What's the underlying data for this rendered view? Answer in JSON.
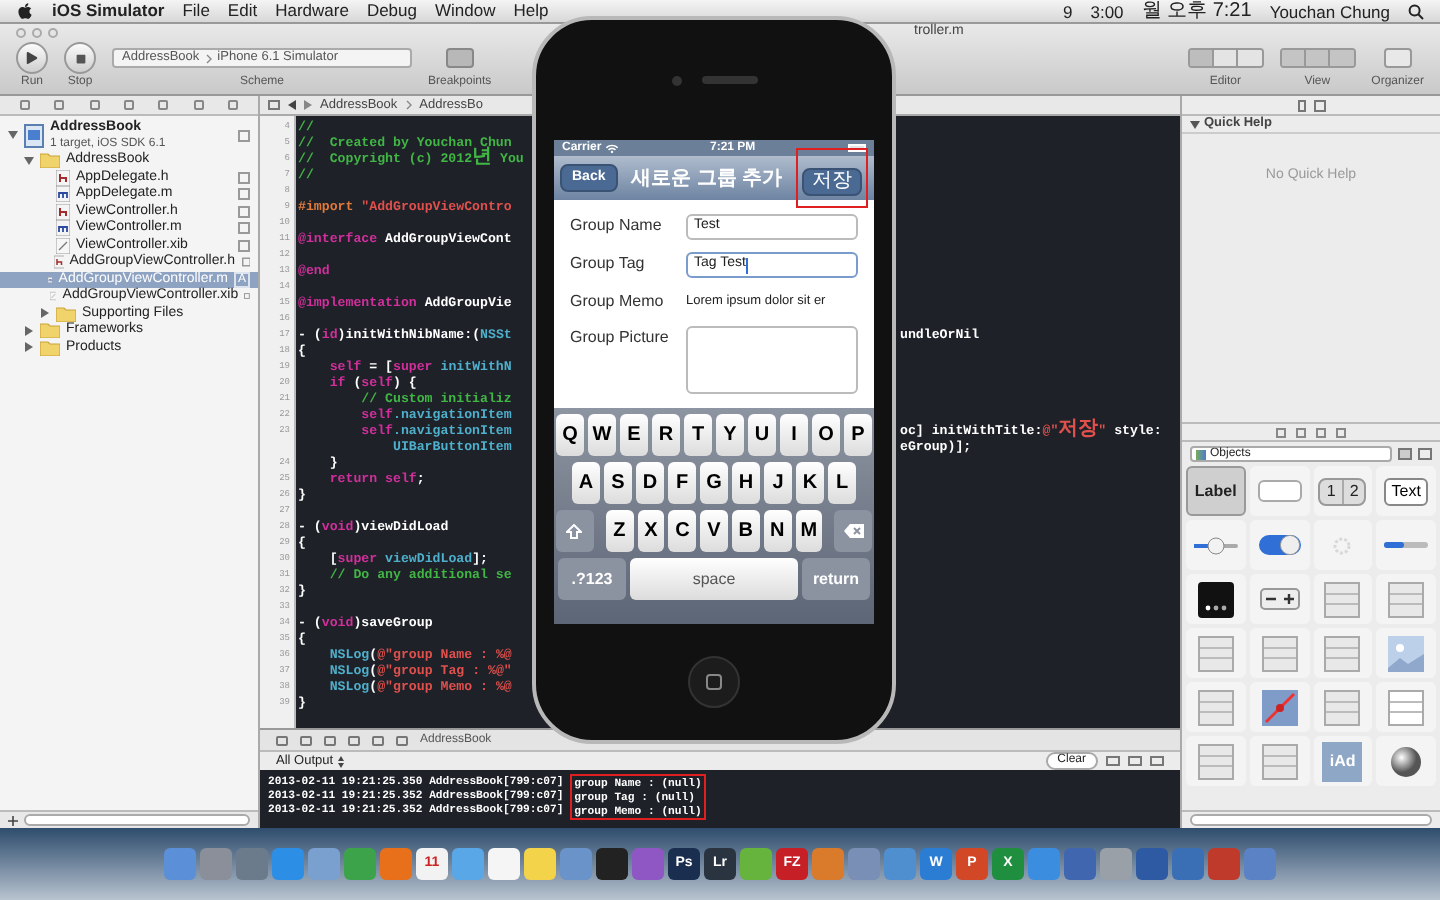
{
  "menu_bar": {
    "app": "iOS Simulator",
    "items": [
      "File",
      "Edit",
      "Hardware",
      "Debug",
      "Window",
      "Help"
    ],
    "status": [
      "9",
      "3:00",
      "월 오후 7:21",
      "Youchan Chung"
    ]
  },
  "toolbar": {
    "title": "troller.m",
    "run": "Run",
    "stop": "Stop",
    "scheme_target": "AddressBook",
    "scheme_device": "iPhone 6.1 Simulator",
    "scheme_label": "Scheme",
    "breakpoints": "Breakpoints",
    "editor": "Editor",
    "view": "View",
    "organizer": "Organizer"
  },
  "navigator": {
    "tree": [
      {
        "label": "AddressBook",
        "detail": "1 target, iOS SDK 6.1",
        "kind": "project",
        "expanded": true,
        "selected": false,
        "children": [
          {
            "label": "AddressBook",
            "kind": "group",
            "expanded": true,
            "selected": false,
            "children": [
              {
                "label": "AppDelegate.h",
                "kind": "header",
                "selected": false
              },
              {
                "label": "AppDelegate.m",
                "kind": "source",
                "selected": false
              },
              {
                "label": "ViewController.h",
                "kind": "header",
                "selected": false
              },
              {
                "label": "ViewController.m",
                "kind": "source",
                "selected": false
              },
              {
                "label": "ViewController.xib",
                "kind": "xib",
                "selected": false
              },
              {
                "label": "AddGroupViewController.h",
                "kind": "header",
                "selected": false
              },
              {
                "label": "AddGroupViewController.m",
                "kind": "source",
                "selected": true,
                "status": "A"
              },
              {
                "label": "AddGroupViewController.xib",
                "kind": "xib",
                "selected": false
              },
              {
                "label": "Supporting Files",
                "kind": "group",
                "expanded": false,
                "selected": false
              }
            ]
          },
          {
            "label": "Frameworks",
            "kind": "group",
            "expanded": false,
            "selected": false
          },
          {
            "label": "Products",
            "kind": "group",
            "expanded": false,
            "selected": false
          }
        ]
      }
    ]
  },
  "jump_bar": [
    "AddressBook",
    "AddressBo"
  ],
  "code": [
    {
      "n": "4",
      "segs": [
        {
          "text": "//",
          "kind": "comment"
        }
      ]
    },
    {
      "n": "5",
      "segs": [
        {
          "text": "//  Created by Youchan Chun",
          "kind": "comment"
        }
      ]
    },
    {
      "n": "6",
      "segs": [
        {
          "text": "//  Copyright (c) 2012년 You",
          "kind": "comment"
        }
      ]
    },
    {
      "n": "7",
      "segs": [
        {
          "text": "//",
          "kind": "comment"
        }
      ]
    },
    {
      "n": "8"
    },
    {
      "n": "9",
      "segs": [
        {
          "text": "#import",
          "kind": "directive"
        },
        {
          "text": " \"AddGroupViewContro",
          "kind": "string"
        }
      ]
    },
    {
      "n": "10"
    },
    {
      "n": "11",
      "segs": [
        {
          "text": "@interface",
          "kind": "keyword"
        },
        {
          "text": " AddGroupViewCont",
          "kind": "plain"
        }
      ]
    },
    {
      "n": "12"
    },
    {
      "n": "13",
      "segs": [
        {
          "text": "@end",
          "kind": "keyword"
        }
      ]
    },
    {
      "n": "14"
    },
    {
      "n": "15",
      "segs": [
        {
          "text": "@implementation",
          "kind": "keyword"
        },
        {
          "text": " AddGroupVie",
          "kind": "plain"
        }
      ]
    },
    {
      "n": "16"
    },
    {
      "n": "17",
      "segs": [
        {
          "text": "- (",
          "kind": "plain"
        },
        {
          "text": "id",
          "kind": "keyword"
        },
        {
          "text": ")initWithNibName:(",
          "kind": "plain"
        },
        {
          "text": "NSSt",
          "kind": "type"
        }
      ],
      "right": [
        {
          "text": "undleOrNil",
          "kind": "plain"
        }
      ]
    },
    {
      "n": "18",
      "segs": [
        {
          "text": "{",
          "kind": "plain"
        }
      ]
    },
    {
      "n": "19",
      "segs": [
        {
          "text": "    self",
          "kind": "keyword"
        },
        {
          "text": " = [",
          "kind": "plain"
        },
        {
          "text": "super",
          "kind": "keyword"
        },
        {
          "text": " initWithN",
          "kind": "type"
        }
      ]
    },
    {
      "n": "20",
      "segs": [
        {
          "text": "    if",
          "kind": "keyword"
        },
        {
          "text": " (",
          "kind": "plain"
        },
        {
          "text": "self",
          "kind": "keyword"
        },
        {
          "text": ") {",
          "kind": "plain"
        }
      ]
    },
    {
      "n": "21",
      "segs": [
        {
          "text": "        // Custom initializ",
          "kind": "comment"
        }
      ]
    },
    {
      "n": "22",
      "segs": [
        {
          "text": "        self",
          "kind": "keyword"
        },
        {
          "text": ".navigationItem",
          "kind": "type"
        }
      ]
    },
    {
      "n": "23",
      "segs": [
        {
          "text": "        self",
          "kind": "keyword"
        },
        {
          "text": ".navigationItem",
          "kind": "type"
        }
      ],
      "right": [
        {
          "text": "oc] initWithTitle:",
          "kind": "plain"
        },
        {
          "text": "@\"저장\"",
          "kind": "string"
        },
        {
          "text": " style:",
          "kind": "plain"
        }
      ]
    },
    {
      "segs": [
        {
          "text": "            UIBarButtonItem",
          "kind": "type"
        }
      ],
      "right": [
        {
          "text": "eGroup)];",
          "kind": "plain"
        }
      ]
    },
    {
      "n": "24",
      "segs": [
        {
          "text": "    }",
          "kind": "plain"
        }
      ]
    },
    {
      "n": "25",
      "segs": [
        {
          "text": "    return",
          "kind": "keyword"
        },
        {
          "text": " self",
          "kind": "keyword"
        },
        {
          "text": ";",
          "kind": "plain"
        }
      ]
    },
    {
      "n": "26",
      "segs": [
        {
          "text": "}",
          "kind": "plain"
        }
      ]
    },
    {
      "n": "27"
    },
    {
      "n": "28",
      "segs": [
        {
          "text": "- (",
          "kind": "plain"
        },
        {
          "text": "void",
          "kind": "keyword"
        },
        {
          "text": ")viewDidLoad",
          "kind": "plain"
        }
      ]
    },
    {
      "n": "29",
      "segs": [
        {
          "text": "{",
          "kind": "plain"
        }
      ]
    },
    {
      "n": "30",
      "segs": [
        {
          "text": "    [",
          "kind": "plain"
        },
        {
          "text": "super",
          "kind": "keyword"
        },
        {
          "text": " viewDidLoad",
          "kind": "type"
        },
        {
          "text": "];",
          "kind": "plain"
        }
      ]
    },
    {
      "n": "31",
      "segs": [
        {
          "text": "    // Do any additional se",
          "kind": "comment"
        }
      ]
    },
    {
      "n": "32",
      "segs": [
        {
          "text": "}",
          "kind": "plain"
        }
      ]
    },
    {
      "n": "33"
    },
    {
      "n": "34",
      "segs": [
        {
          "text": "- (",
          "kind": "plain"
        },
        {
          "text": "void",
          "kind": "keyword"
        },
        {
          "text": ")saveGroup",
          "kind": "plain"
        }
      ]
    },
    {
      "n": "35",
      "segs": [
        {
          "text": "{",
          "kind": "plain"
        }
      ]
    },
    {
      "n": "36",
      "segs": [
        {
          "text": "    NSLog",
          "kind": "type"
        },
        {
          "text": "(",
          "kind": "plain"
        },
        {
          "text": "@\"group Name : %@",
          "kind": "string"
        }
      ]
    },
    {
      "n": "37",
      "segs": [
        {
          "text": "    NSLog",
          "kind": "type"
        },
        {
          "text": "(",
          "kind": "plain"
        },
        {
          "text": "@\"group Tag : %@\"",
          "kind": "string"
        }
      ]
    },
    {
      "n": "38",
      "segs": [
        {
          "text": "    NSLog",
          "kind": "type"
        },
        {
          "text": "(",
          "kind": "plain"
        },
        {
          "text": "@\"group Memo : %@",
          "kind": "string"
        }
      ]
    },
    {
      "n": "39",
      "segs": [
        {
          "text": "}",
          "kind": "plain"
        }
      ]
    }
  ],
  "debug": {
    "crumb": "AddressBook",
    "output_filter": "All Output",
    "clear": "Clear",
    "highlighted": true,
    "log": [
      {
        "prefix": "2013-02-11 19:21:25.350 AddressBook[799:c07]",
        "message": "group Name : (null)"
      },
      {
        "prefix": "2013-02-11 19:21:25.352 AddressBook[799:c07]",
        "message": "group Tag : (null)"
      },
      {
        "prefix": "2013-02-11 19:21:25.352 AddressBook[799:c07]",
        "message": "group Memo : (null)"
      }
    ]
  },
  "simulator": {
    "carrier": "Carrier",
    "time": "7:21 PM",
    "back": "Back",
    "title": "새로운 그룹 추가",
    "save": {
      "label": "저장",
      "highlighted": true
    },
    "form": [
      {
        "label": "Group Name",
        "kind": "field",
        "value": "Test",
        "focused": false
      },
      {
        "label": "Group Tag",
        "kind": "field",
        "value": "Tag Test",
        "focused": true
      },
      {
        "label": "Group Memo",
        "kind": "text",
        "value": "Lorem ipsum dolor sit er"
      },
      {
        "label": "Group Picture",
        "kind": "picture"
      }
    ],
    "keyboard": [
      [
        "Q",
        "W",
        "E",
        "R",
        "T",
        "Y",
        "U",
        "I",
        "O",
        "P"
      ],
      [
        "A",
        "S",
        "D",
        "F",
        "G",
        "H",
        "J",
        "K",
        "L"
      ],
      [
        "Z",
        "X",
        "C",
        "V",
        "B",
        "N",
        "M"
      ]
    ],
    "numbers_key": ".?123",
    "space_key": "space",
    "return_key": "return"
  },
  "utilities": {
    "quick_help": "Quick Help",
    "no_help": "No Quick Help",
    "library": "Objects",
    "tiles": [
      {
        "kind": "label",
        "label": "Label",
        "selected": true
      },
      {
        "kind": "round_button",
        "selected": false
      },
      {
        "kind": "segmented",
        "segments": [
          "1",
          "2"
        ],
        "selected": false
      },
      {
        "kind": "text_field",
        "label": "Text",
        "selected": false
      },
      {
        "kind": "slider",
        "selected": false
      },
      {
        "kind": "switch",
        "selected": false
      },
      {
        "kind": "activity",
        "selected": false
      },
      {
        "kind": "progress",
        "selected": false
      },
      {
        "kind": "page_control",
        "selected": false
      },
      {
        "kind": "stepper",
        "selected": false
      },
      {
        "kind": "table",
        "selected": false
      },
      {
        "kind": "grouped_table",
        "selected": false
      },
      {
        "kind": "collection",
        "selected": false
      },
      {
        "kind": "split",
        "selected": false
      },
      {
        "kind": "navigation",
        "selected": false
      },
      {
        "kind": "image",
        "selected": false
      },
      {
        "kind": "text_view",
        "selected": false
      },
      {
        "kind": "map",
        "selected": false
      },
      {
        "kind": "web",
        "selected": false
      },
      {
        "kind": "view",
        "selected": false
      },
      {
        "kind": "toolbar",
        "selected": false
      },
      {
        "kind": "tab_bar",
        "selected": false
      },
      {
        "kind": "iad",
        "label": "iAd",
        "selected": false
      },
      {
        "kind": "sphere",
        "selected": false
      }
    ]
  },
  "dock": [
    {
      "color": "#5b8fd8"
    },
    {
      "color": "#8a8f99"
    },
    {
      "color": "#6b7b8c"
    },
    {
      "color": "#2d8ee6"
    },
    {
      "color": "#7aa0d0"
    },
    {
      "color": "#3da34a"
    },
    {
      "color": "#e8701a"
    },
    {
      "color": "#f2f2f2",
      "glyph": "11"
    },
    {
      "color": "#5aa7e8"
    },
    {
      "color": "#f5f5f5"
    },
    {
      "color": "#f3d34a"
    },
    {
      "color": "#6a93c9"
    },
    {
      "color": "#222222"
    },
    {
      "color": "#8f57c4"
    },
    {
      "color": "#1a2f4f",
      "glyph": "Ps"
    },
    {
      "color": "#2a3340",
      "glyph": "Lr"
    },
    {
      "color": "#66b33e"
    },
    {
      "color": "#c62026",
      "glyph": "FZ"
    },
    {
      "color": "#d97b2a"
    },
    {
      "color": "#7a8fb5"
    },
    {
      "color": "#4f8fd0"
    },
    {
      "color": "#2b7cd3",
      "glyph": "W"
    },
    {
      "color": "#d24726",
      "glyph": "P"
    },
    {
      "color": "#1f8f3f",
      "glyph": "X"
    },
    {
      "color": "#3b8de0"
    },
    {
      "color": "#4166b0"
    },
    {
      "color": "#9aa0a8"
    },
    {
      "color": "#2d5aa3"
    },
    {
      "color": "#3a6fb5"
    },
    {
      "color": "#c03a2b"
    },
    {
      "color": "#5b82c4"
    }
  ]
}
